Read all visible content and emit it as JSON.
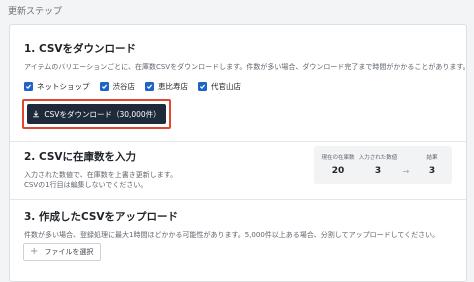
{
  "header": {
    "title": "更新ステップ"
  },
  "step1": {
    "title": "1. CSVをダウンロード",
    "desc": "アイテムのバリエーションごとに、在庫数CSVをダウンロードします。件数が多い場合、ダウンロード完了まで時間がかかることがあります。",
    "stores": [
      {
        "label": "ネットショップ",
        "checked": true
      },
      {
        "label": "渋谷店",
        "checked": true
      },
      {
        "label": "恵比寿店",
        "checked": true
      },
      {
        "label": "代官山店",
        "checked": true
      }
    ],
    "download_label": "CSVをダウンロード（30,000件）",
    "highlight_color": "#e0472d"
  },
  "step2": {
    "title": "2. CSVに在庫数を入力",
    "desc_line1": "入力された数値で、在庫数を上書き更新します。",
    "desc_line2": "CSVの1行目は編集しないでください。",
    "stats": {
      "current_label": "現在の在庫数",
      "current_value": "20",
      "input_label": "入力された数値",
      "input_value": "3",
      "result_label": "結果",
      "result_value": "3",
      "arrow": "→"
    }
  },
  "step3": {
    "title": "3. 作成したCSVをアップロード",
    "desc": "件数が多い場合、登録処理に最大1時間ほどかかる可能性があります。5,000件以上ある場合、分割してアップロードしてください。",
    "select_file_label": "ファイルを選択",
    "plus": "+"
  },
  "colors": {
    "accent": "#1e63c8",
    "button_dark": "#1e2a3a"
  }
}
